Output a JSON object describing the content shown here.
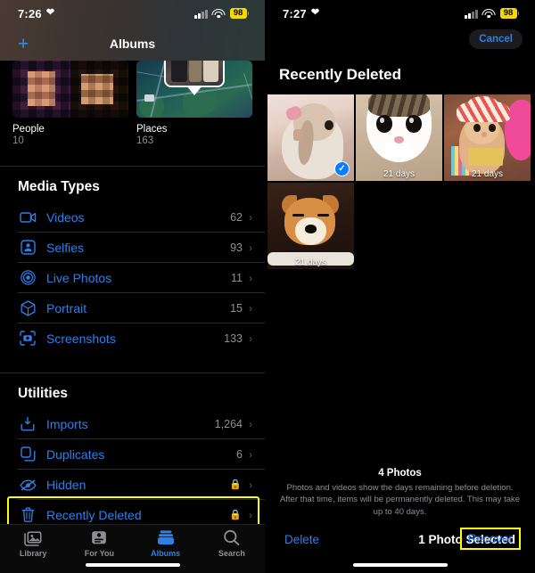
{
  "left": {
    "statusbar": {
      "time": "7:26",
      "heart_icon": "heart-icon",
      "signal_icon": "cellular-bars-icon",
      "wifi_icon": "wifi-icon",
      "battery": "98"
    },
    "nav": {
      "add_icon": "plus-icon",
      "title": "Albums"
    },
    "album_tiles": [
      {
        "name": "People",
        "count": "10",
        "thumb": "people-faces-thumbnail"
      },
      {
        "name": "Places",
        "count": "163",
        "thumb": "map-places-thumbnail"
      }
    ],
    "sections": [
      {
        "header": "Media Types",
        "rows": [
          {
            "icon": "video-camera-icon",
            "label": "Videos",
            "count": "62",
            "locked": false
          },
          {
            "icon": "selfie-person-icon",
            "label": "Selfies",
            "count": "93",
            "locked": false
          },
          {
            "icon": "live-photo-icon",
            "label": "Live Photos",
            "count": "11",
            "locked": false
          },
          {
            "icon": "portrait-cube-icon",
            "label": "Portrait",
            "count": "15",
            "locked": false
          },
          {
            "icon": "screenshot-icon",
            "label": "Screenshots",
            "count": "133",
            "locked": false
          }
        ]
      },
      {
        "header": "Utilities",
        "rows": [
          {
            "icon": "import-arrow-icon",
            "label": "Imports",
            "count": "1,264",
            "locked": false
          },
          {
            "icon": "duplicates-icon",
            "label": "Duplicates",
            "count": "6",
            "locked": false
          },
          {
            "icon": "hidden-eye-icon",
            "label": "Hidden",
            "count": "",
            "locked": true
          },
          {
            "icon": "trash-icon",
            "label": "Recently Deleted",
            "count": "",
            "locked": true,
            "highlighted": true
          }
        ]
      }
    ],
    "tabs": [
      {
        "icon": "library-icon",
        "label": "Library",
        "active": false
      },
      {
        "icon": "for-you-icon",
        "label": "For You",
        "active": false
      },
      {
        "icon": "albums-icon",
        "label": "Albums",
        "active": true
      },
      {
        "icon": "search-icon",
        "label": "Search",
        "active": false
      }
    ]
  },
  "right": {
    "statusbar": {
      "time": "7:27",
      "heart_icon": "heart-icon",
      "signal_icon": "cellular-bars-icon",
      "wifi_icon": "wifi-icon",
      "battery": "98"
    },
    "nav": {
      "cancel_label": "Cancel",
      "title": "Recently Deleted"
    },
    "photos": [
      {
        "subject": "rabbit-photo",
        "days": "",
        "selected": true
      },
      {
        "subject": "cat-photo",
        "days": "21 days",
        "selected": false
      },
      {
        "subject": "hamster-photo",
        "days": "21 days",
        "selected": false
      },
      {
        "subject": "shiba-dog-photo",
        "days": "21 days",
        "selected": false
      }
    ],
    "footer": {
      "count_label": "4 Photos",
      "description": "Photos and videos show the days remaining before deletion. After that time, items will be permanently deleted. This may take up to 40 days.",
      "delete_label": "Delete",
      "selection_label": "1 Photo Selected",
      "recover_label": "Recover"
    }
  },
  "colors": {
    "accent_blue": "#2f7fe8",
    "highlight_yellow": "#ffff00",
    "secondary_gray": "#8e8e93",
    "battery_yellow": "#f5d800"
  }
}
